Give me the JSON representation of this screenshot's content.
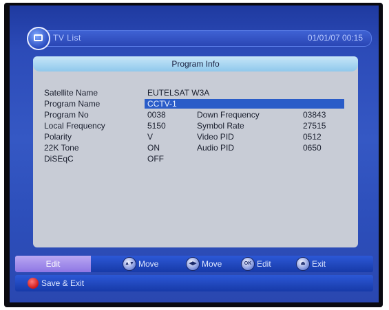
{
  "title_bar": {
    "title": "TV List",
    "datetime": "01/01/07 00:15"
  },
  "panel": {
    "header": "Program Info",
    "left_labels": [
      "Satellite Name",
      "Program Name",
      "Program No",
      "Local Frequency",
      "Polarity",
      "22K Tone",
      "DiSEqC"
    ],
    "left_values": [
      "EUTELSAT W3A",
      "CCTV-1",
      "0038",
      "5150",
      "V",
      "ON",
      "OFF"
    ],
    "right_labels": [
      "Down Frequency",
      "Symbol Rate",
      "Video PID",
      "Audio PID"
    ],
    "right_values": [
      "03843",
      "27515",
      "0512",
      "0650"
    ]
  },
  "footer": {
    "tab": "Edit",
    "hints": [
      {
        "icon": "up-down-icon",
        "glyph": "▲▼",
        "label": "Move"
      },
      {
        "icon": "left-right-icon",
        "glyph": "◀▶",
        "label": "Move"
      },
      {
        "icon": "ok-icon",
        "glyph": "OK",
        "label": "Edit"
      },
      {
        "icon": "exit-icon",
        "glyph": "⏏",
        "label": "Exit"
      }
    ],
    "save_exit": "Save & Exit"
  },
  "colors": {
    "screen": "#2c4bb8",
    "panel": "#c8ccd6",
    "highlight": "#2a5cc8",
    "edit_tab": "#9b85ea",
    "red_button": "#d01818"
  }
}
